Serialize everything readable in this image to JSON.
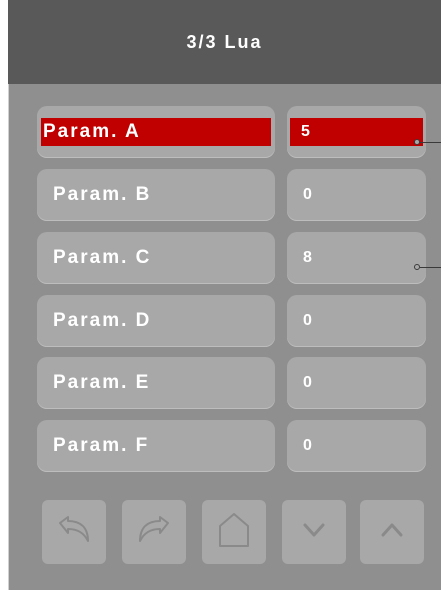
{
  "header": {
    "title": "3/3 Lua"
  },
  "rows": [
    {
      "name": "Param. A",
      "value": "5"
    },
    {
      "name": "Param. B",
      "value": "0"
    },
    {
      "name": "Param. C",
      "value": "8"
    },
    {
      "name": "Param. D",
      "value": "0"
    },
    {
      "name": "Param. E",
      "value": "0"
    },
    {
      "name": "Param. F",
      "value": "0"
    }
  ],
  "colors": {
    "selected": "#c00000",
    "panel": "#8f8f8f",
    "header": "#595959",
    "field": "#a8a8a8"
  },
  "toolbar": {
    "icons": [
      "undo-icon",
      "redo-icon",
      "home-icon",
      "chevron-down-icon",
      "chevron-up-icon"
    ]
  }
}
